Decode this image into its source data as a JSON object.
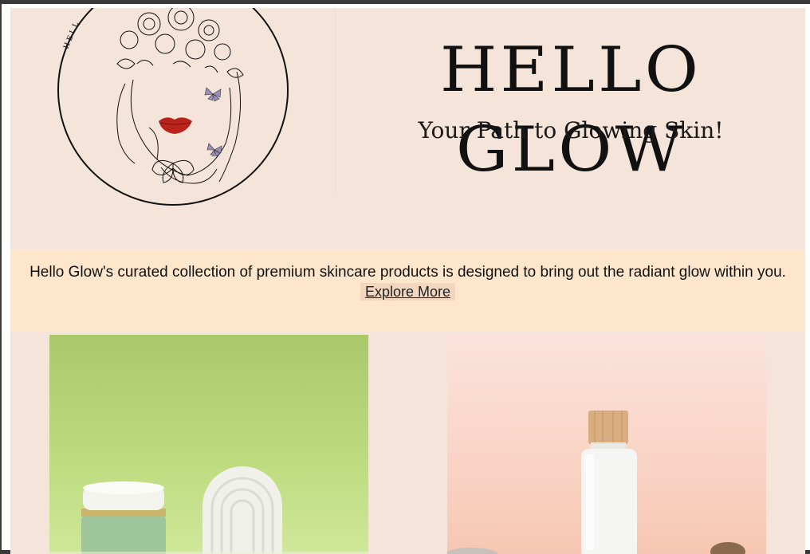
{
  "brand": {
    "title": "HELLO GLOW",
    "tagline": "Your Path to Glowing Skin!",
    "logo_arc_text": "HELL"
  },
  "intro": {
    "text": "Hello Glow's curated collection of premium skincare products is designed to bring out the radiant glow within you.",
    "cta_label": "Explore More"
  },
  "products": [
    {
      "photo": "green-jar-and-arch-photo"
    },
    {
      "photo": "frosted-bottle-wood-cap-photo"
    }
  ],
  "colors": {
    "page_bg": "#f5e4da",
    "intro_bg": "#fde6cc",
    "lips": "#b8241c",
    "butterfly": "#9b8fbf"
  }
}
